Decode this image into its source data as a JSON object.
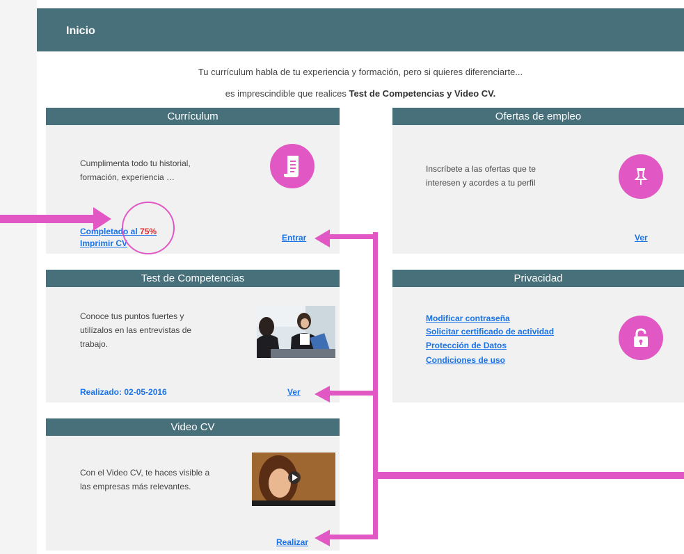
{
  "header": {
    "title": "Inicio"
  },
  "intro": {
    "line1": "Tu currículum habla de tu experiencia y formación, pero si quieres diferenciarte...",
    "line2_prefix": "es imprescindible que realices ",
    "line2_bold": "Test de Competencias y Video CV."
  },
  "cards": {
    "curriculum": {
      "title": "Currículum",
      "text_line1": "Cumplimenta todo tu historial,",
      "text_line2": "formación, experiencia …",
      "icon": "document-scroll-icon",
      "completed_prefix": "Completado al ",
      "completed_pct": "75%",
      "completed_value": 0.75,
      "print_label": "Imprimir CV",
      "action_label": "Entrar"
    },
    "offers": {
      "title": "Ofertas de empleo",
      "text_line1": "Inscríbete a las ofertas que te",
      "text_line2": "interesen y acordes a tu perfil",
      "icon": "pushpin-icon",
      "action_label": "Ver"
    },
    "test": {
      "title": "Test de Competencias",
      "text_line1": "Conoce tus puntos fuertes y",
      "text_line2": "utilízalos en las entrevistas de",
      "text_line3": "trabajo.",
      "status_label": "Realizado: 02-05-2016",
      "action_label": "Ver"
    },
    "privacy": {
      "title": "Privacidad",
      "links": [
        "Modificar contraseña",
        "Solicitar certificado de actividad",
        "Protección de Datos",
        "Condiciones de uso"
      ],
      "icon": "unlocked-padlock-icon"
    },
    "video": {
      "title": "Video CV",
      "text_line1": "Con el Video CV, te haces visible a",
      "text_line2": "las empresas más relevantes.",
      "action_label": "Realizar"
    }
  },
  "colors": {
    "header": "#47707b",
    "card_bg": "#f1f1f1",
    "accent_pink": "#e157c3",
    "link_blue": "#1a73e8",
    "percent_red": "#e8262c"
  }
}
